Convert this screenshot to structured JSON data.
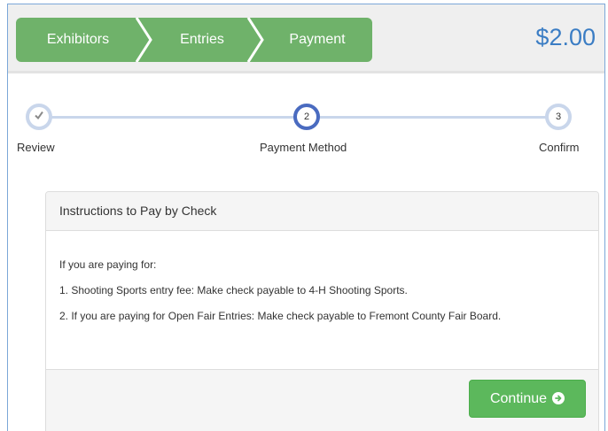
{
  "header": {
    "breadcrumbs": [
      "Exhibitors",
      "Entries",
      "Payment"
    ],
    "total": "$2.00"
  },
  "stepper": {
    "steps": [
      {
        "number": "",
        "label": "Review",
        "state": "done"
      },
      {
        "number": "2",
        "label": "Payment Method",
        "state": "active"
      },
      {
        "number": "3",
        "label": "Confirm",
        "state": "todo"
      }
    ]
  },
  "panel": {
    "heading": "Instructions to Pay by Check",
    "lines": [
      "If you are paying for:",
      "1. Shooting Sports entry fee: Make check payable to 4-H Shooting Sports.",
      "2. If you are paying for Open Fair Entries: Make check payable to Fremont County Fair Board."
    ],
    "continue_label": "Continue"
  },
  "colors": {
    "breadcrumb_green": "#6fb26a",
    "button_green": "#5cb85c",
    "total_blue": "#3b7dc4",
    "active_step_blue": "#4a6bc0"
  },
  "icons": {
    "review_step": "checkmark-icon",
    "continue": "circle-arrow-right-icon"
  }
}
